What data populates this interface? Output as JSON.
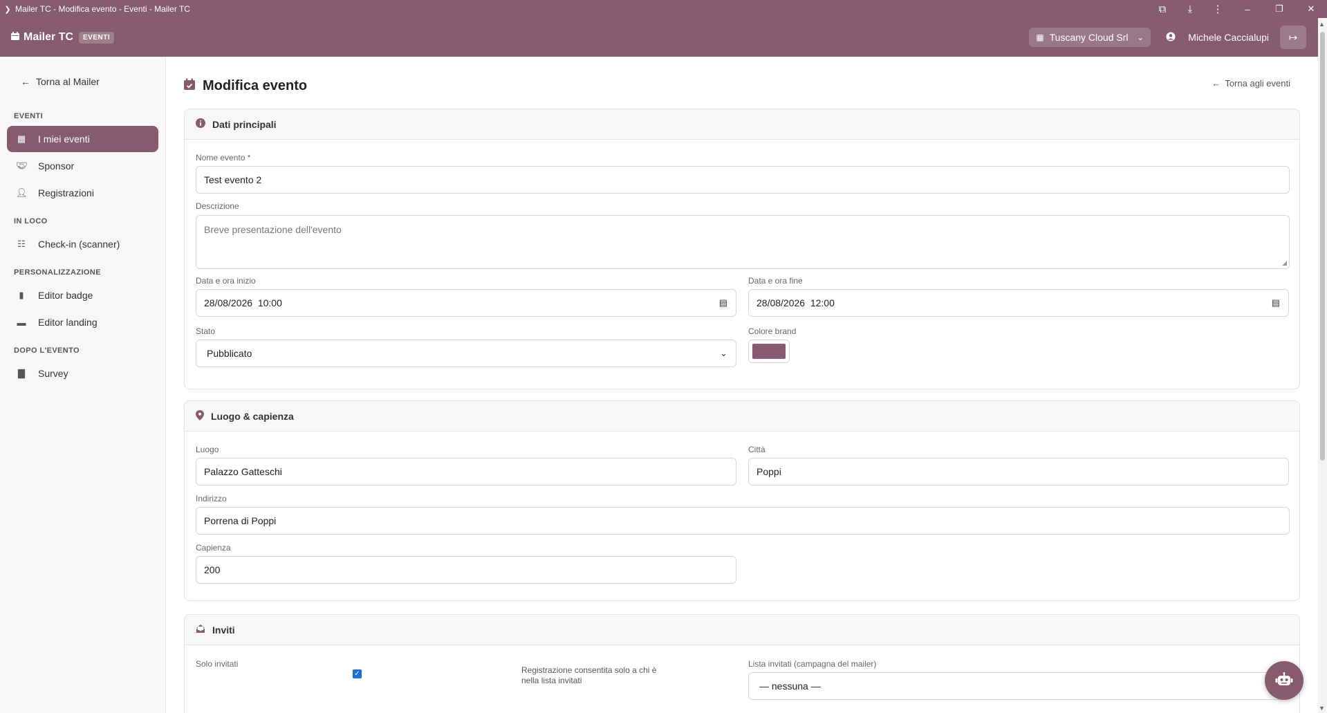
{
  "window": {
    "title": "Mailer TC - Modifica evento - Eventi - Mailer TC"
  },
  "header": {
    "brand": "Mailer TC",
    "badge": "EVENTI",
    "org": "Tuscany Cloud Srl",
    "user": "Michele Caccialupi"
  },
  "sidebar": {
    "back": "Torna al Mailer",
    "sections": {
      "eventi": "EVENTI",
      "inloco": "IN LOCO",
      "personalizzazione": "PERSONALIZZAZIONE",
      "dopo": "DOPO L'EVENTO"
    },
    "items": [
      {
        "label": "I miei eventi",
        "icon": "calendar-icon"
      },
      {
        "label": "Sponsor",
        "icon": "handshake-icon"
      },
      {
        "label": "Registrazioni",
        "icon": "user-check-icon"
      },
      {
        "label": "Check-in (scanner)",
        "icon": "qr-icon"
      },
      {
        "label": "Editor badge",
        "icon": "badge-icon"
      },
      {
        "label": "Editor landing",
        "icon": "window-icon"
      },
      {
        "label": "Survey",
        "icon": "chart-icon"
      }
    ]
  },
  "main": {
    "title": "Modifica evento",
    "back_events": "Torna agli eventi",
    "card1": {
      "title": "Dati principali",
      "nome_label": "Nome evento *",
      "nome_value": "Test evento 2",
      "descr_label": "Descrizione",
      "descr_placeholder": "Breve presentazione dell'evento",
      "inizio_label": "Data e ora inizio",
      "inizio_value": "28/08/2026  10:00",
      "fine_label": "Data e ora fine",
      "fine_value": "28/08/2026  12:00",
      "stato_label": "Stato",
      "stato_value": "Pubblicato",
      "colore_label": "Colore brand",
      "colore_value": "#865b6d"
    },
    "card2": {
      "title": "Luogo & capienza",
      "luogo_label": "Luogo",
      "luogo_value": "Palazzo Gatteschi",
      "citta_label": "Città",
      "citta_value": "Poppi",
      "indirizzo_label": "Indirizzo",
      "indirizzo_value": "Porrena di Poppi",
      "capienza_label": "Capienza",
      "capienza_value": "200"
    },
    "card3": {
      "title": "Inviti",
      "solo_label": "Solo invitati",
      "solo_checked": true,
      "solo_hint": "Registrazione consentita solo a chi è nella lista invitati",
      "lista_label": "Lista invitati (campagna del mailer)",
      "lista_value": "— nessuna —"
    }
  },
  "colors": {
    "brand": "#865b6d"
  }
}
